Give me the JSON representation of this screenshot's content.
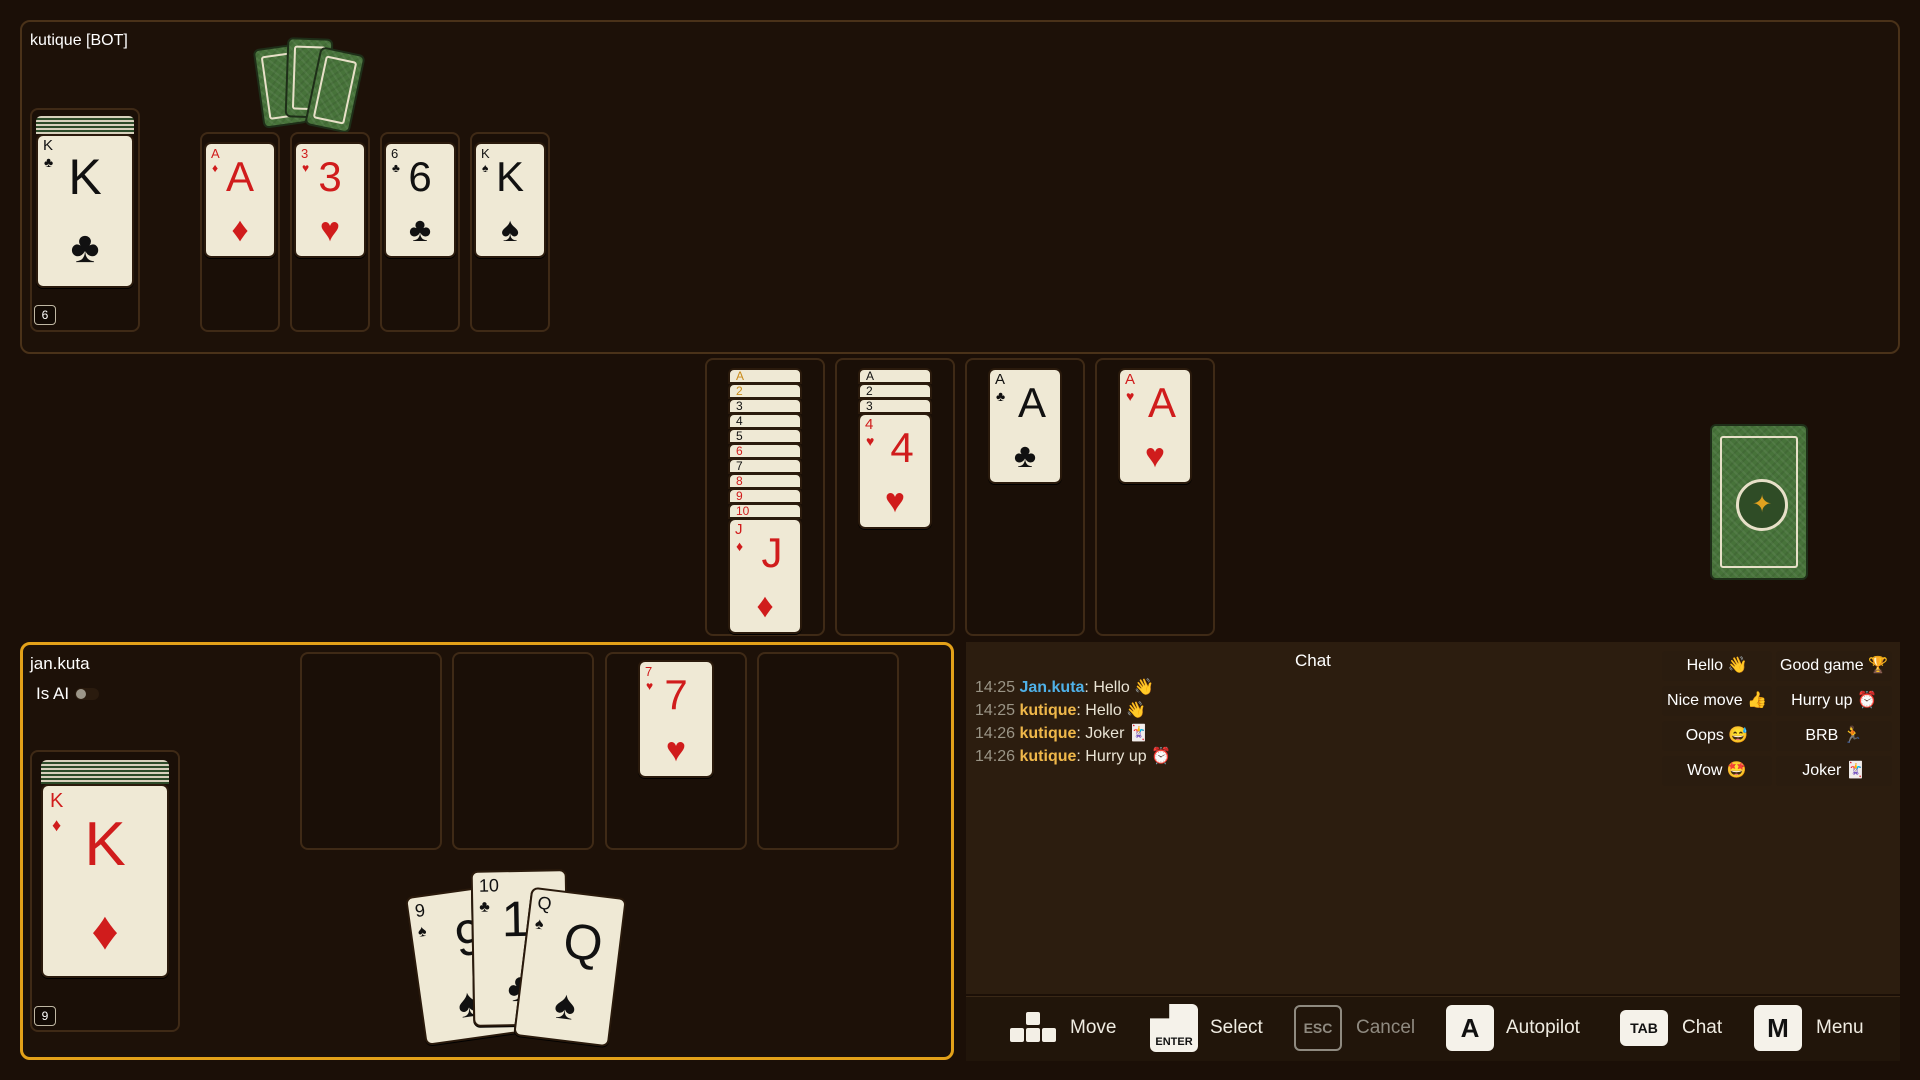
{
  "opponent": {
    "name": "kutique [BOT]",
    "pile_count": "6"
  },
  "player": {
    "name": "jan.kuta",
    "is_ai_label": "Is AI",
    "pile_count": "9"
  },
  "chat": {
    "title": "Chat",
    "messages": [
      {
        "time": "14:25",
        "user": "Jan.kuta",
        "text": ": Hello 👋"
      },
      {
        "time": "14:25",
        "user": "kutique",
        "text": ": Hello 👋"
      },
      {
        "time": "14:26",
        "user": "kutique",
        "text": ": Joker 🃏"
      },
      {
        "time": "14:26",
        "user": "kutique",
        "text": ": Hurry up ⏰"
      }
    ],
    "quick": [
      "Hello 👋",
      "Good game 🏆",
      "Nice move 👍",
      "Hurry up ⏰",
      "Oops 😅",
      "BRB 🏃",
      "Wow 🤩",
      "Joker 🃏"
    ]
  },
  "hints": {
    "move": "Move",
    "select": "Select",
    "cancel": "Cancel",
    "autopilot": "Autopilot",
    "chat": "Chat",
    "menu": "Menu",
    "keys": {
      "enter": "ENTER",
      "esc": "ESC",
      "a": "A",
      "tab": "TAB",
      "m": "M"
    }
  },
  "cards": {
    "opp_pile": {
      "rank": "K",
      "suit": "♣"
    },
    "opp_discard": [
      {
        "rank": "A",
        "suit": "♦"
      },
      {
        "rank": "3",
        "suit": "♥"
      },
      {
        "rank": "6",
        "suit": "♣"
      },
      {
        "rank": "K",
        "suit": "♠"
      }
    ],
    "build1_stack": [
      "A",
      "2",
      "3",
      "4",
      "5",
      "6",
      "7",
      "8",
      "9",
      "10"
    ],
    "build1_top": {
      "rank": "J",
      "suit": "♦"
    },
    "build2_stack": [
      "A",
      "2",
      "3"
    ],
    "build2_top": {
      "rank": "4",
      "suit": "♥"
    },
    "build3_top": {
      "rank": "A",
      "suit": "♣"
    },
    "build4_top": {
      "rank": "A",
      "suit": "♥"
    },
    "player_pile": {
      "rank": "K",
      "suit": "♦"
    },
    "player_discard": {
      "rank": "7",
      "suit": "♥"
    },
    "hand": [
      {
        "rank": "9",
        "suit": "♠"
      },
      {
        "rank": "10",
        "suit": "♣"
      },
      {
        "rank": "Q",
        "suit": "♠"
      }
    ]
  }
}
